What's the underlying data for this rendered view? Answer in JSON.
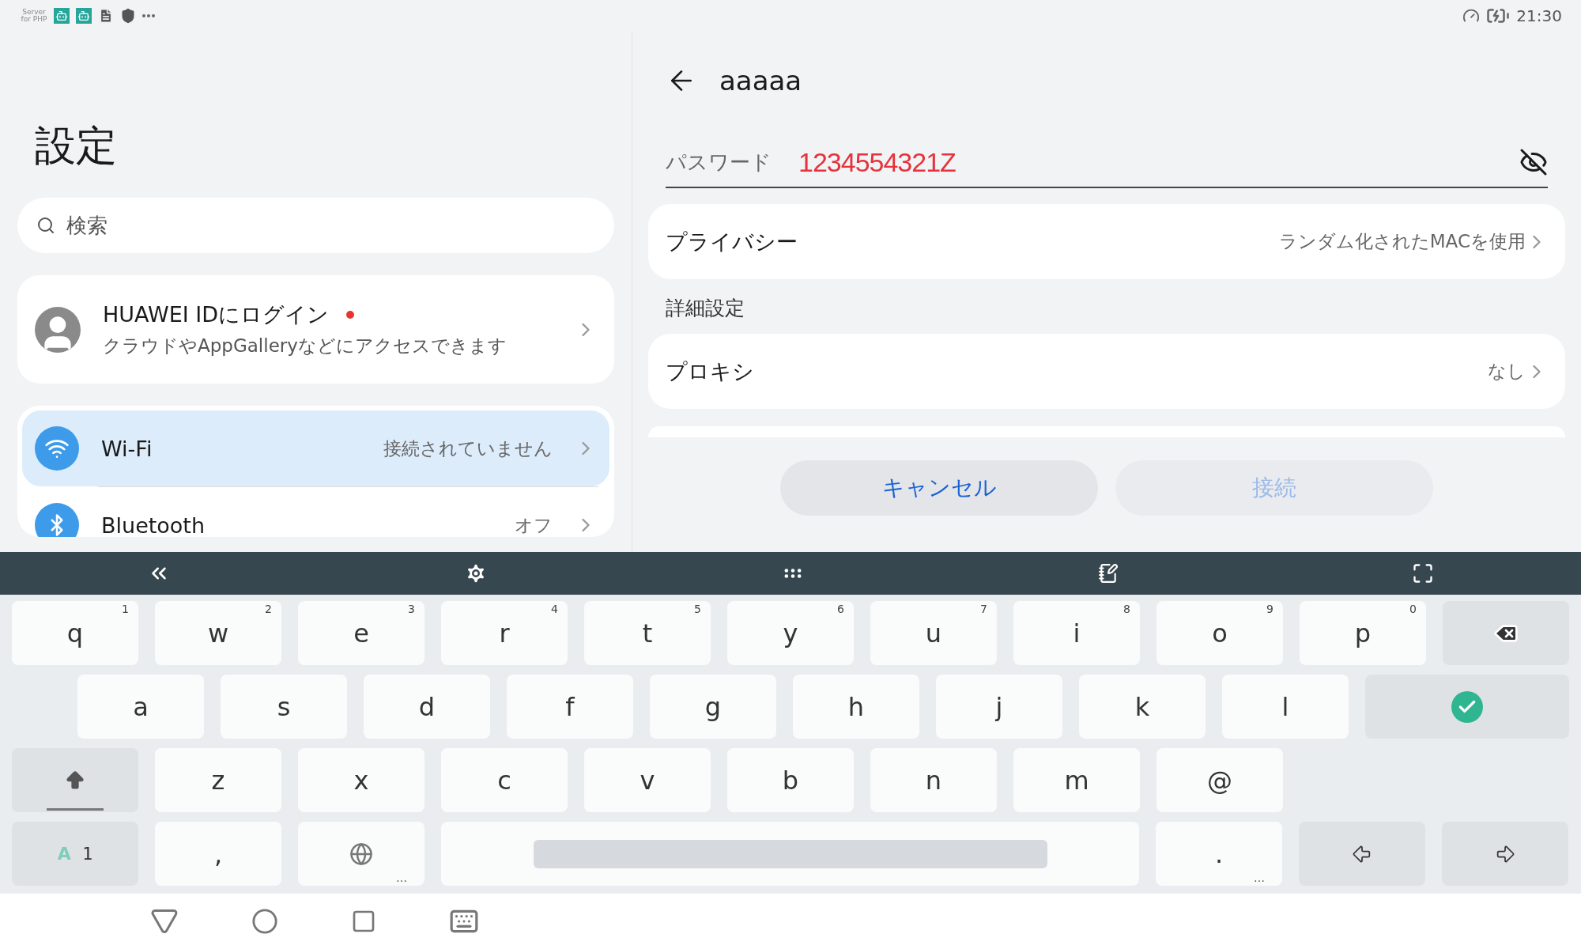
{
  "status_bar": {
    "app_label": "Server for PHP",
    "time": "21:30"
  },
  "settings": {
    "title": "設定",
    "search": {
      "placeholder": "検索"
    },
    "account": {
      "title": "HUAWEI IDにログイン",
      "subtitle": "クラウドやAppGalleryなどにアクセスできます",
      "has_notification": true
    },
    "items": [
      {
        "kind": "wifi",
        "label": "Wi-Fi",
        "value": "接続されていません",
        "selected": true
      },
      {
        "kind": "bluetooth",
        "label": "Bluetooth",
        "value": "オフ",
        "selected": false
      }
    ]
  },
  "network": {
    "title": "aaaaa",
    "password": {
      "label": "パスワード",
      "value": "1234554321Z"
    },
    "privacy": {
      "label": "プライバシー",
      "value": "ランダム化されたMACを使用"
    },
    "section": "詳細設定",
    "proxy": {
      "label": "プロキシ",
      "value": "なし"
    },
    "buttons": [
      {
        "label": "キャンセル",
        "disabled": false
      },
      {
        "label": "接続",
        "disabled": true
      }
    ]
  },
  "keyboard": {
    "rows": [
      {
        "keys": [
          {
            "kind": "char",
            "label": "q",
            "hint": "1"
          },
          {
            "kind": "char",
            "label": "w",
            "hint": "2"
          },
          {
            "kind": "char",
            "label": "e",
            "hint": "3"
          },
          {
            "kind": "char",
            "label": "r",
            "hint": "4"
          },
          {
            "kind": "char",
            "label": "t",
            "hint": "5"
          },
          {
            "kind": "char",
            "label": "y",
            "hint": "6"
          },
          {
            "kind": "char",
            "label": "u",
            "hint": "7"
          },
          {
            "kind": "char",
            "label": "i",
            "hint": "8"
          },
          {
            "kind": "char",
            "label": "o",
            "hint": "9"
          },
          {
            "kind": "char",
            "label": "p",
            "hint": "0"
          },
          {
            "kind": "backspace"
          }
        ]
      },
      {
        "keys": [
          {
            "kind": "char",
            "label": "a"
          },
          {
            "kind": "char",
            "label": "s"
          },
          {
            "kind": "char",
            "label": "d"
          },
          {
            "kind": "char",
            "label": "f"
          },
          {
            "kind": "char",
            "label": "g"
          },
          {
            "kind": "char",
            "label": "h"
          },
          {
            "kind": "char",
            "label": "j"
          },
          {
            "kind": "char",
            "label": "k"
          },
          {
            "kind": "char",
            "label": "l"
          },
          {
            "kind": "enter"
          }
        ]
      },
      {
        "keys": [
          {
            "kind": "shift"
          },
          {
            "kind": "char",
            "label": "z"
          },
          {
            "kind": "char",
            "label": "x"
          },
          {
            "kind": "char",
            "label": "c"
          },
          {
            "kind": "char",
            "label": "v"
          },
          {
            "kind": "char",
            "label": "b"
          },
          {
            "kind": "char",
            "label": "n"
          },
          {
            "kind": "char",
            "label": "m"
          },
          {
            "kind": "char",
            "label": "@"
          }
        ]
      },
      {
        "keys": [
          {
            "kind": "mode",
            "label": "A",
            "label2": "1"
          },
          {
            "kind": "char",
            "label": ","
          },
          {
            "kind": "globe",
            "more": "…"
          },
          {
            "kind": "space"
          },
          {
            "kind": "char",
            "label": ".",
            "more": "…"
          },
          {
            "kind": "left"
          },
          {
            "kind": "right"
          }
        ]
      }
    ]
  }
}
